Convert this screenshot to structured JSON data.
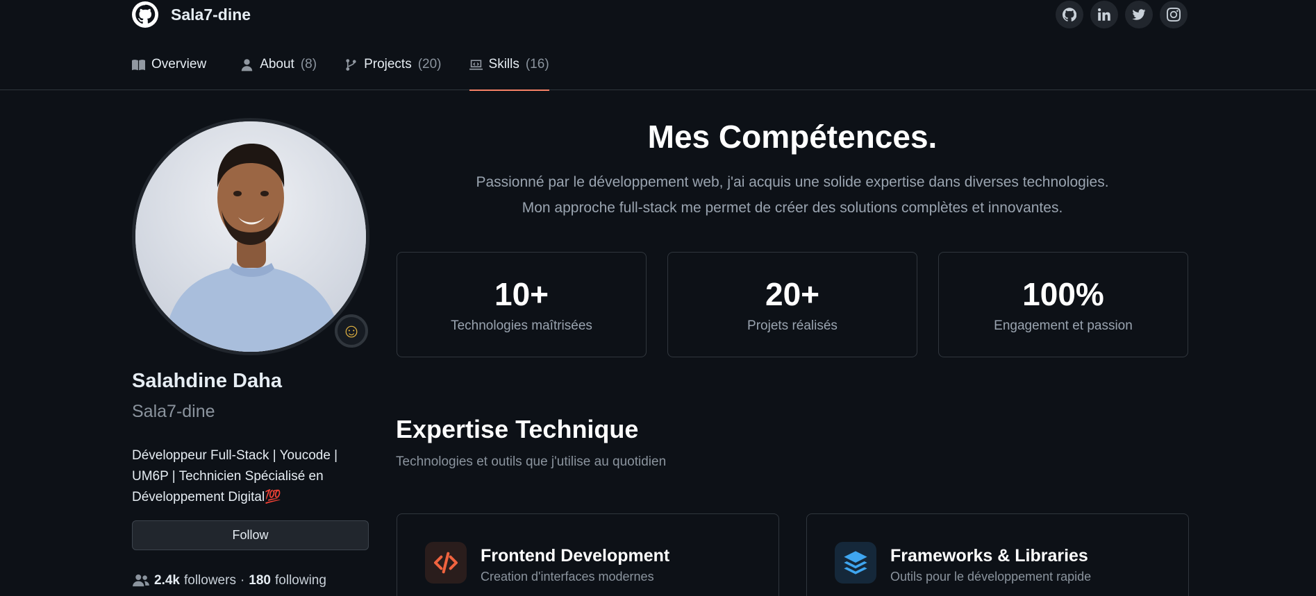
{
  "header": {
    "username": "Sala7-dine",
    "logo_icon": "github-logo-icon",
    "socials": [
      {
        "icon": "github-icon"
      },
      {
        "icon": "linkedin-icon"
      },
      {
        "icon": "twitter-icon"
      },
      {
        "icon": "instagram-icon"
      }
    ]
  },
  "tabs": [
    {
      "label": "Overview",
      "count": "",
      "icon": "book-icon"
    },
    {
      "label": "About",
      "count": "(8)",
      "icon": "person-icon"
    },
    {
      "label": "Projects",
      "count": "(20)",
      "icon": "git-branch-icon"
    },
    {
      "label": "Skills",
      "count": "(16)",
      "icon": "code-screen-icon",
      "active": true
    }
  ],
  "profile": {
    "full_name": "Salahdine Daha",
    "handle": "Sala7-dine",
    "bio": "Développeur Full-Stack | Youcode | UM6P | Technicien Spécialisé en Développement Digital💯",
    "status_emoji": "☺",
    "follow_label": "Follow",
    "followers_count": "2.4k",
    "followers_label": "followers",
    "separator": "·",
    "following_count": "180",
    "following_label": "following"
  },
  "main": {
    "title": "Mes Compétences.",
    "subtitle_line1": "Passionné par le développement web, j'ai acquis une solide expertise dans diverses technologies.",
    "subtitle_line2": "Mon approche full-stack me permet de créer des solutions complètes et innovantes.",
    "stats": [
      {
        "value": "10+",
        "label": "Technologies maîtrisées"
      },
      {
        "value": "20+",
        "label": "Projets réalisés"
      },
      {
        "value": "100%",
        "label": "Engagement et passion"
      }
    ],
    "expertise_title": "Expertise Technique",
    "expertise_subtitle": "Technologies et outils que j'utilise au quotidien",
    "cards": [
      {
        "title": "Frontend Development",
        "subtitle": "Creation d'interfaces modernes",
        "icon": "code-brackets-icon",
        "accent": "#f0633f"
      },
      {
        "title": "Frameworks & Libraries",
        "subtitle": "Outils pour le développement rapide",
        "icon": "layers-icon",
        "accent": "#3fa6f0"
      }
    ]
  },
  "colors": {
    "background": "#0d1117",
    "border": "#30363d",
    "tab_underline": "#f78166",
    "muted_text": "#8b949e"
  }
}
